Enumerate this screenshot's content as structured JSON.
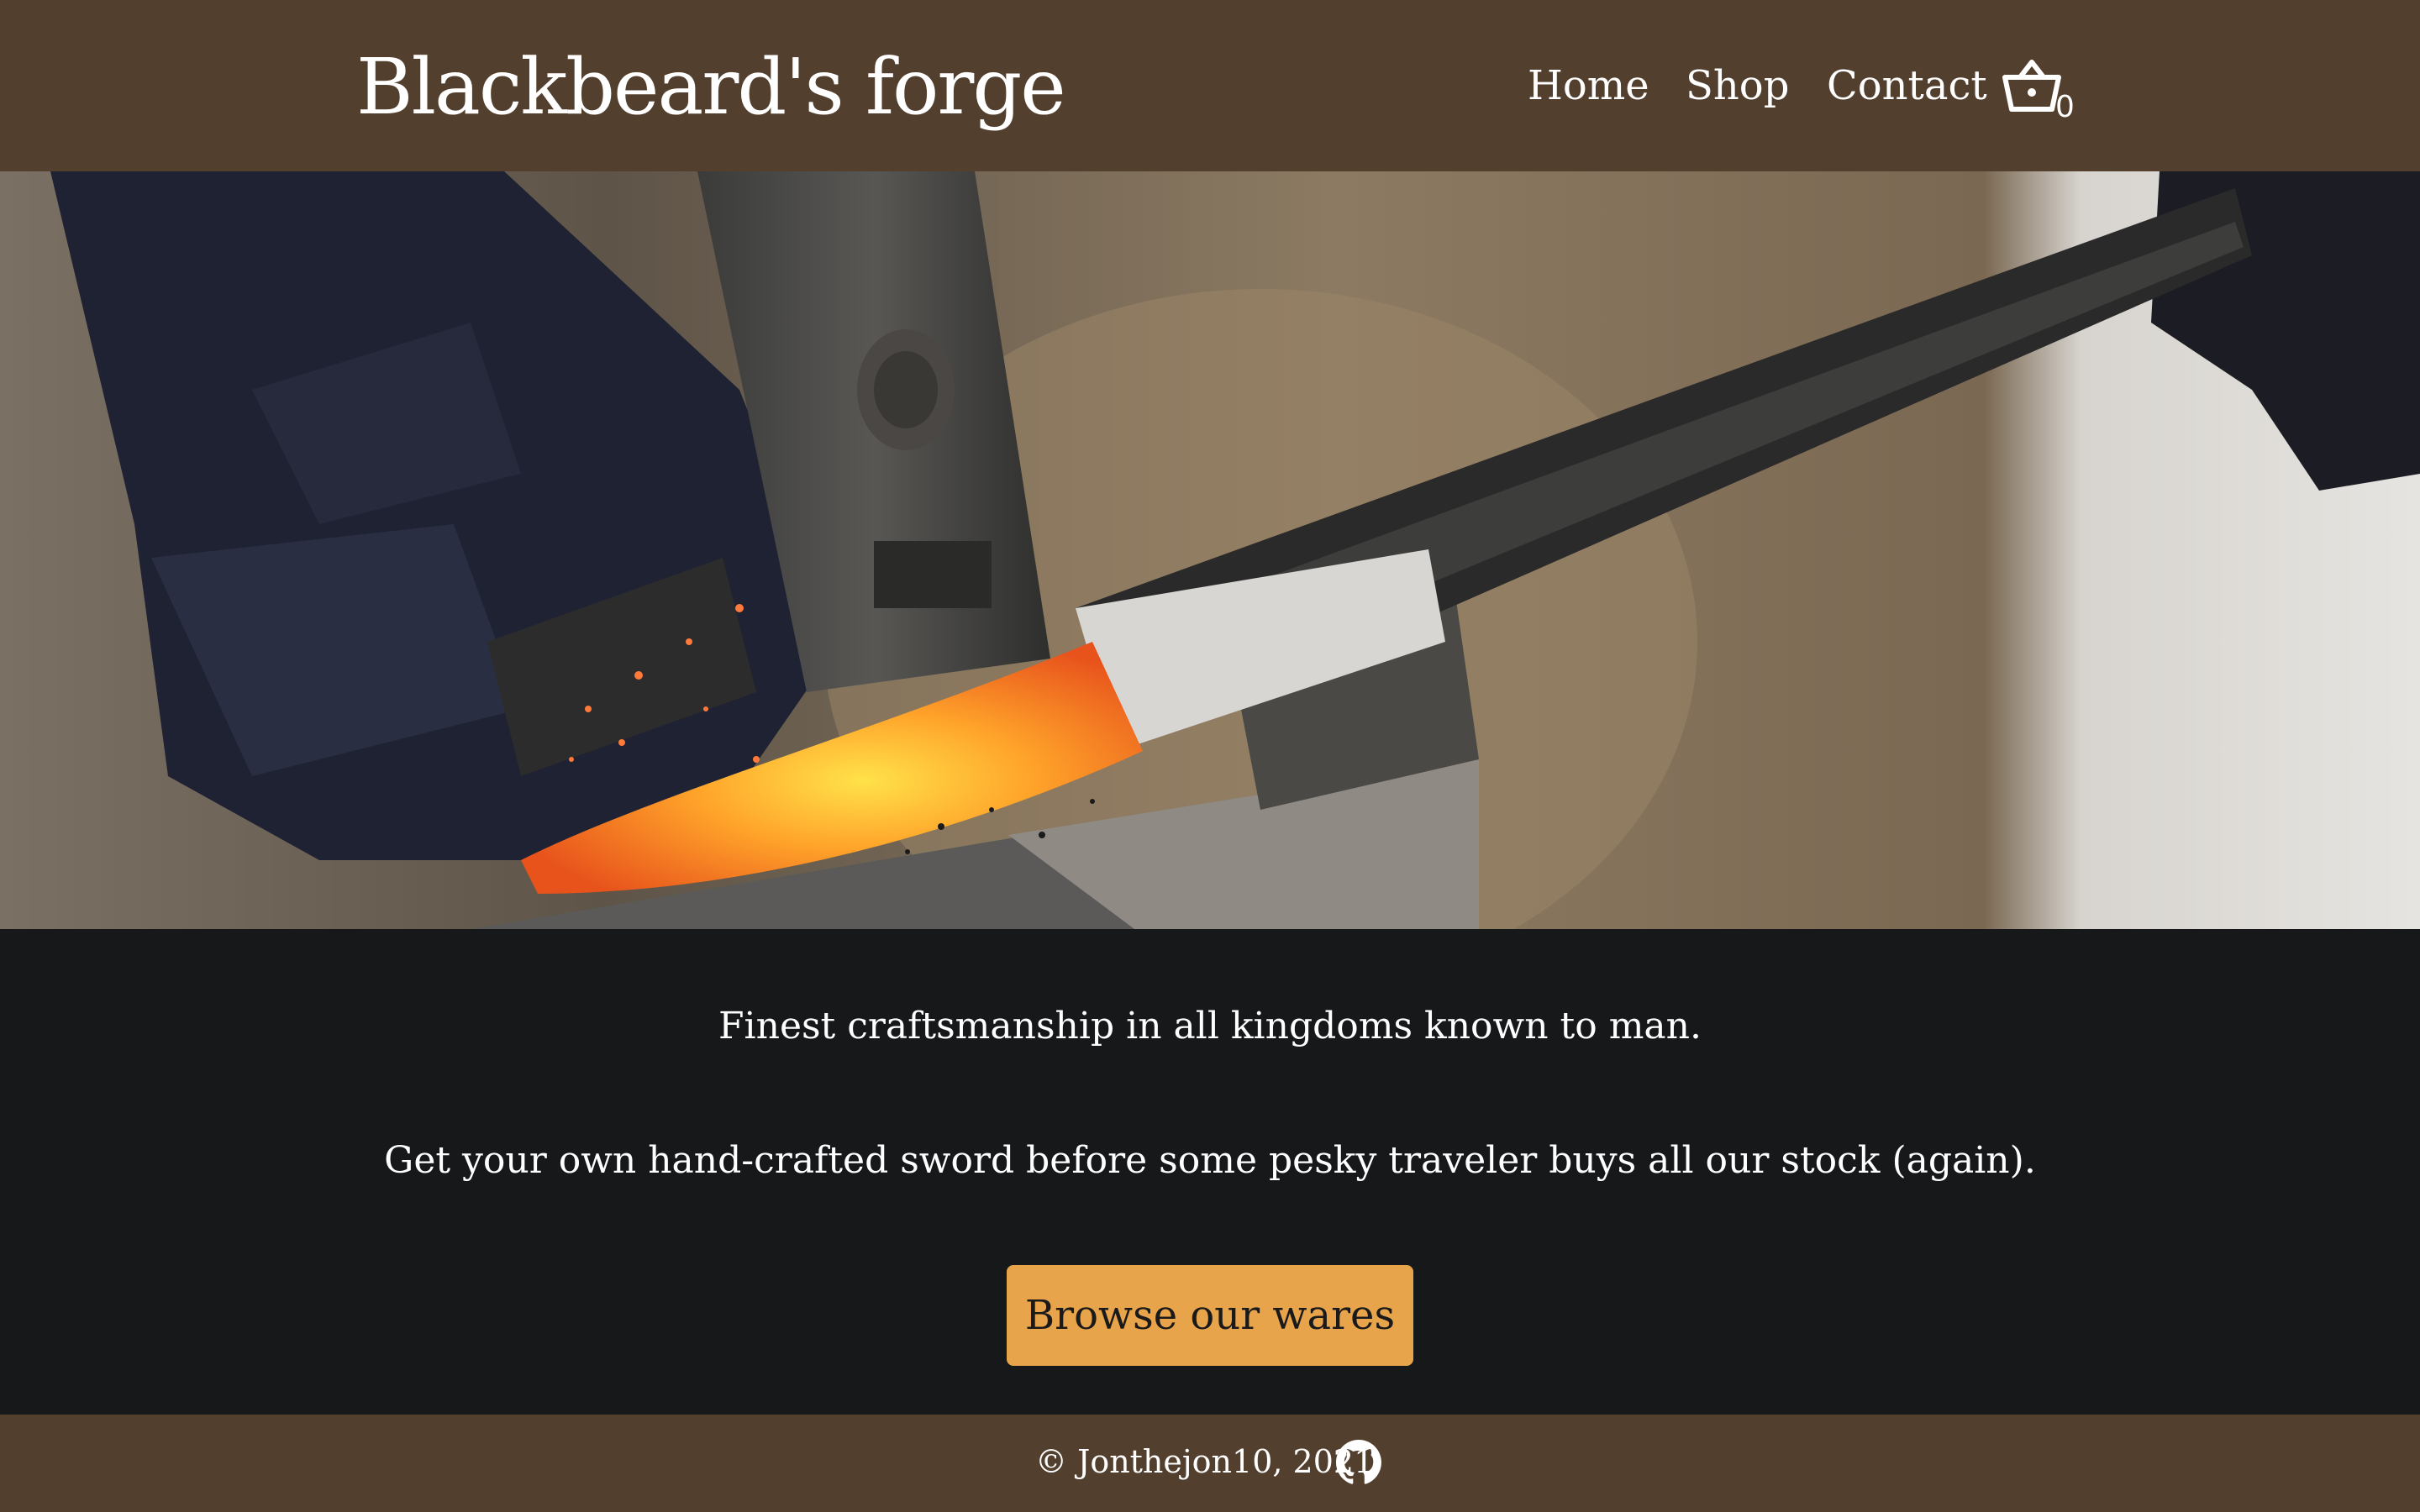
{
  "header": {
    "logo": "Blackbeard's forge",
    "nav": {
      "home": "Home",
      "shop": "Shop",
      "contact": "Contact"
    },
    "cart": {
      "icon": "basket-icon",
      "count": "0"
    }
  },
  "hero": {
    "image": "blacksmith-hammering-glowing-sword-on-anvil"
  },
  "main": {
    "tagline_1": "Finest craftsmanship in all kingdoms known to man.",
    "tagline_2": "Get your own hand-crafted sword before some pesky traveler buys all our stock (again).",
    "cta_label": "Browse our wares"
  },
  "footer": {
    "copyright": "© Jonthejon10, 2021",
    "github_icon": "github-icon"
  },
  "colors": {
    "header_bg": "#533f2e",
    "main_bg": "#17181a",
    "accent": "#e8a44a",
    "text": "#ffffff"
  }
}
